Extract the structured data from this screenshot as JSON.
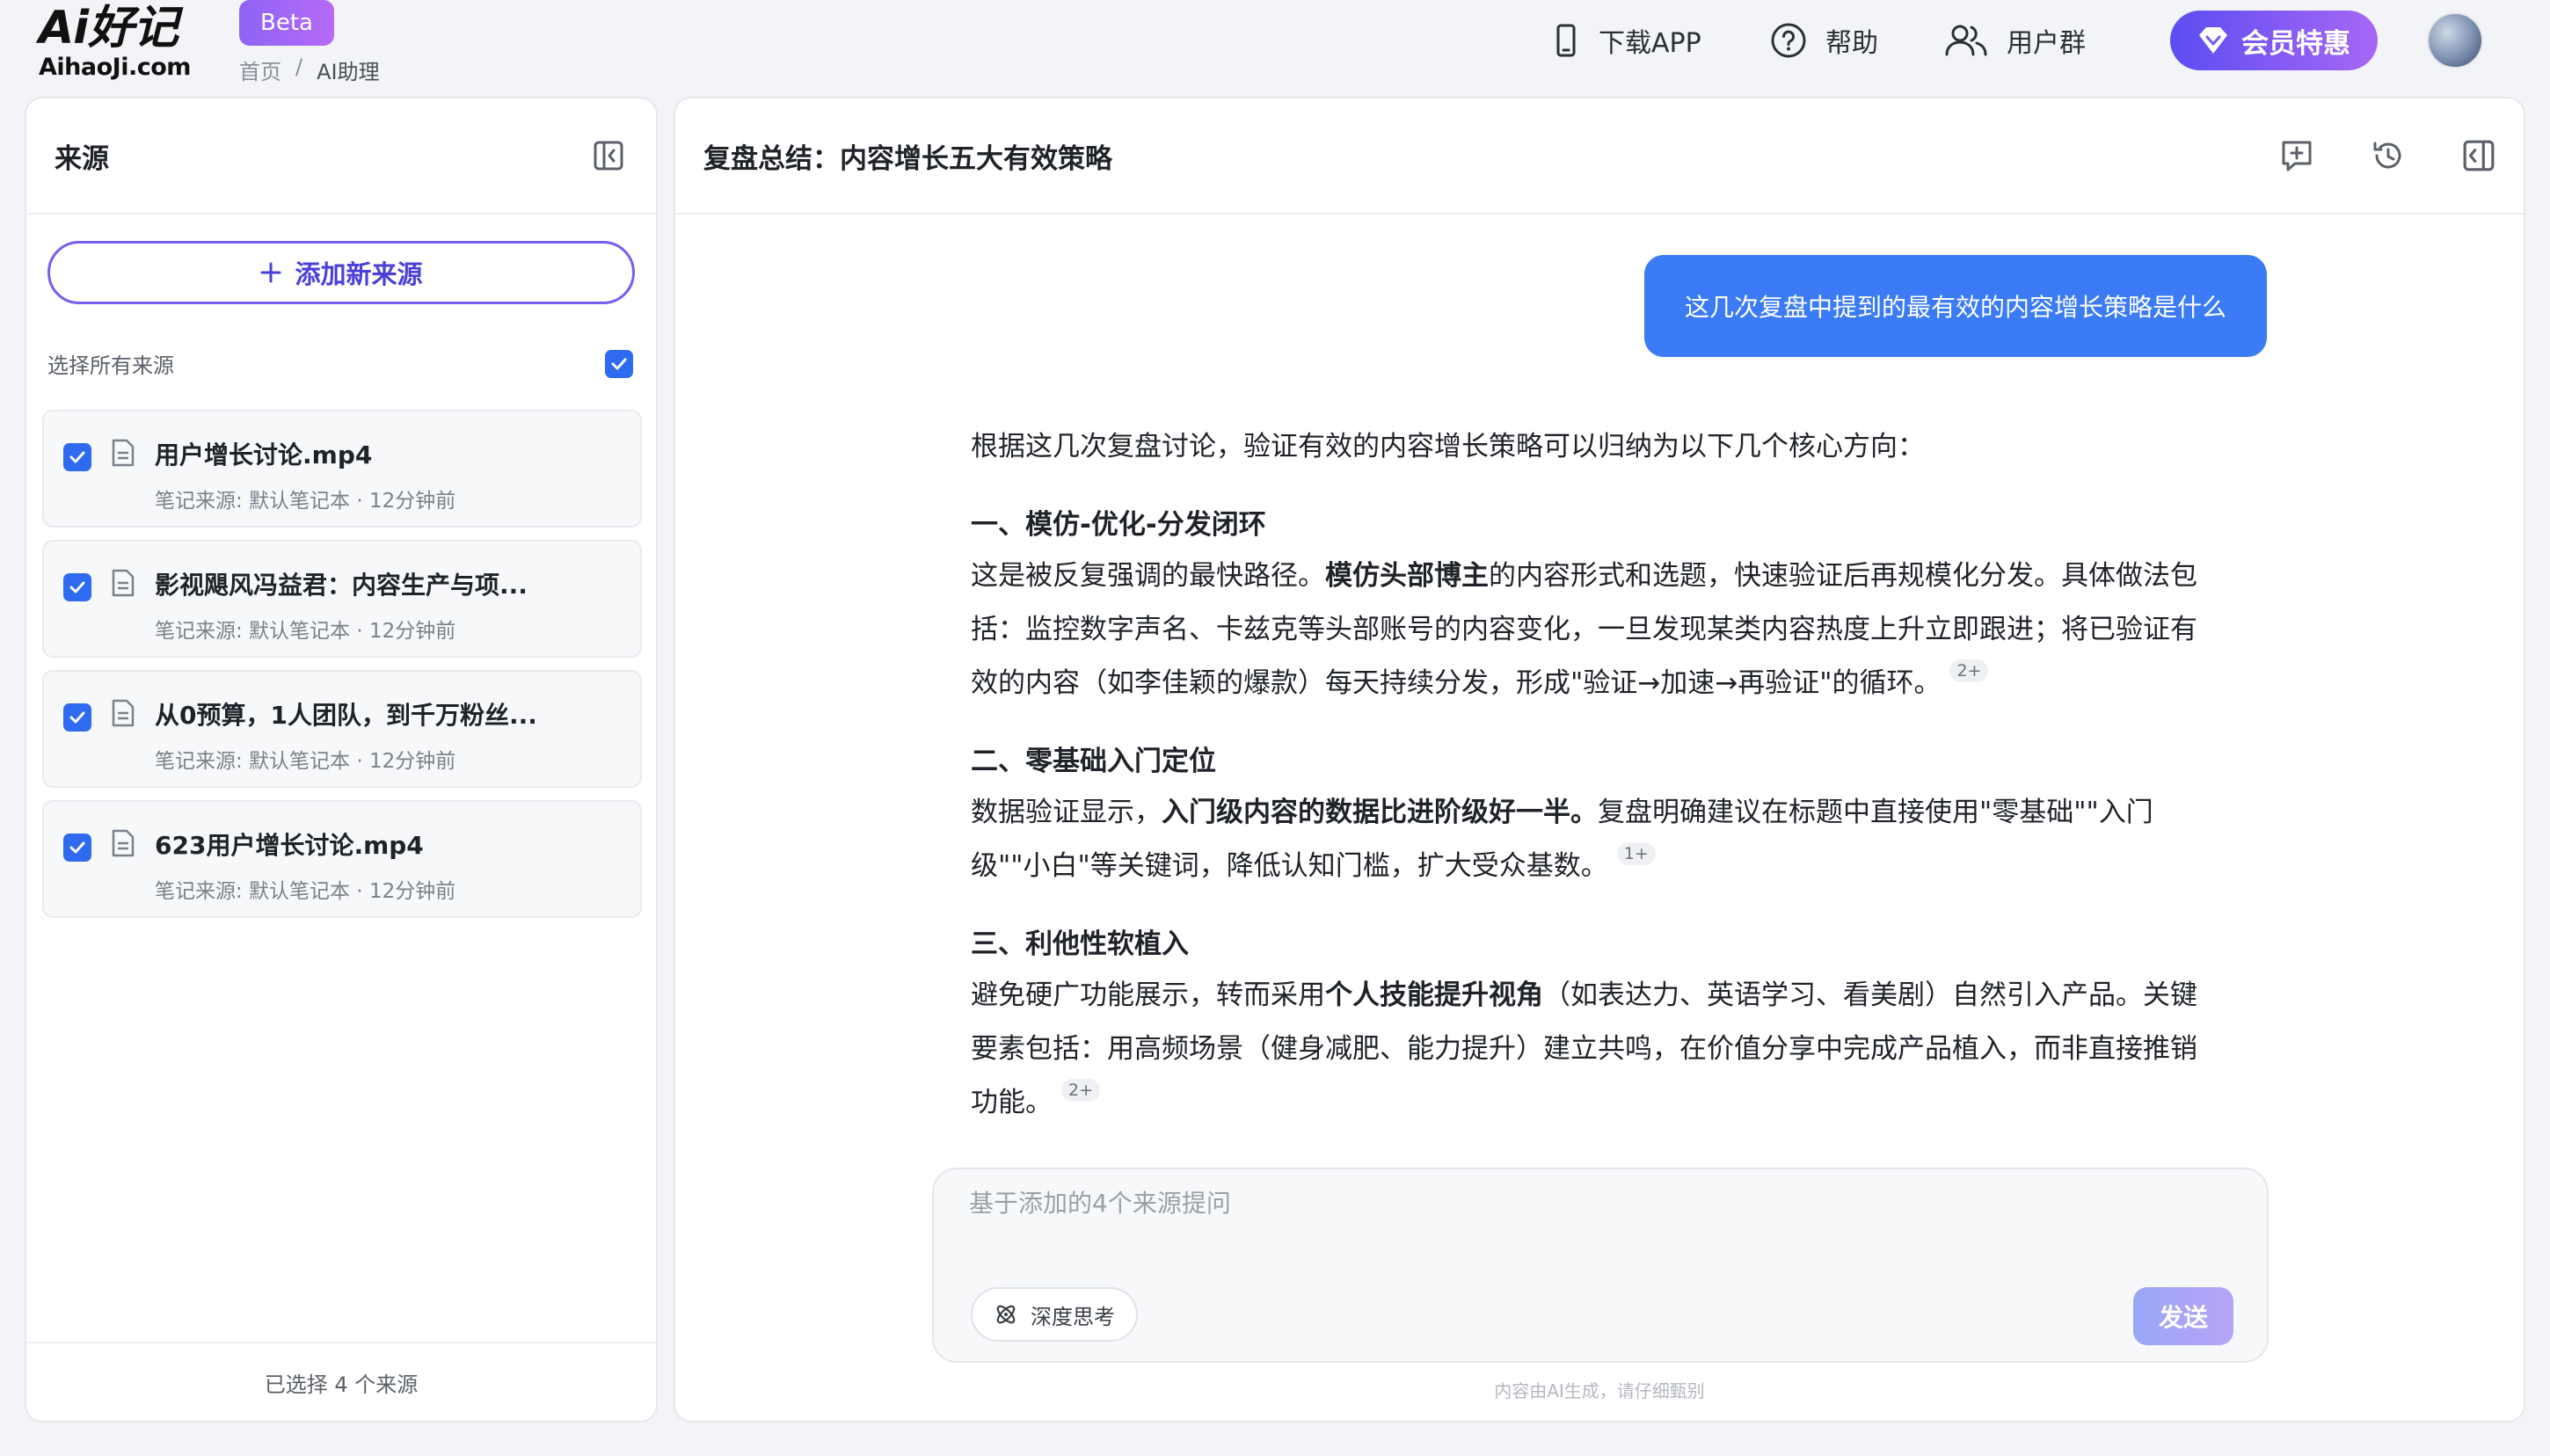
{
  "header": {
    "logo_main": "Ai好记",
    "logo_sub": "AihaoJi.com",
    "beta": "Beta",
    "breadcrumb": [
      "首页",
      "/",
      "AI助理"
    ],
    "nav": {
      "download": "下载APP",
      "help": "帮助",
      "users": "用户群",
      "vip": "会员特惠"
    }
  },
  "sources": {
    "title": "来源",
    "add_label": "添加新来源",
    "select_all": "选择所有来源",
    "items": [
      {
        "name": "用户增长讨论.mp4",
        "meta": "笔记来源: 默认笔记本 · 12分钟前"
      },
      {
        "name": "影视飓风冯益君：内容生产与项...",
        "meta": "笔记来源: 默认笔记本 · 12分钟前"
      },
      {
        "name": "从0预算，1人团队，到千万粉丝...",
        "meta": "笔记来源: 默认笔记本 · 12分钟前"
      },
      {
        "name": "623用户增长讨论.mp4",
        "meta": "笔记来源: 默认笔记本 · 12分钟前"
      }
    ],
    "footer": "已选择 4 个来源"
  },
  "chat": {
    "title": "复盘总结：内容增长五大有效策略",
    "user_message": "这几次复盘中提到的最有效的内容增长策略是什么",
    "intro": "根据这几次复盘讨论，验证有效的内容增长策略可以归纳为以下几个核心方向：",
    "s1": {
      "heading": "一、模仿-优化-分发闭环",
      "a": "这是被反复强调的最快路径。",
      "b": "模仿头部博主",
      "c": "的内容形式和选题，快速验证后再规模化分发。具体做法包括：监控数字声名、卡兹克等头部账号的内容变化，一旦发现某类内容热度上升立即跟进；将已验证有效的内容（如李佳颖的爆款）每天持续分发，形成\"验证→加速→再验证\"的循环。",
      "cite": "2+"
    },
    "s2": {
      "heading": "二、零基础入门定位",
      "a": "数据验证显示，",
      "b": "入门级内容的数据比进阶级好一半。",
      "c": "复盘明确建议在标题中直接使用\"零基础\"\"入门级\"\"小白\"等关键词，降低认知门槛，扩大受众基数。",
      "cite": "1+"
    },
    "s3": {
      "heading": "三、利他性软植入",
      "a": "避免硬广功能展示，转而采用",
      "b": "个人技能提升视角",
      "c": "（如表达力、英语学习、看美剧）自然引入产品。关键要素包括：用高频场景（健身减肥、能力提升）建立共鸣，在价值分享中完成产品植入，而非直接推销功能。",
      "cite": "2+"
    },
    "input_placeholder": "基于添加的4个来源提问",
    "deep_think": "深度思考",
    "send": "发送",
    "disclaimer": "内容由AI生成，请仔细甄别"
  },
  "colors": {
    "accent": "#3b7bf5",
    "brand_purple": "#7a5cf0",
    "checkbox": "#2f6bf0"
  },
  "icons": [
    "phone-icon",
    "help-icon",
    "users-icon",
    "diamond-icon",
    "collapse-icon",
    "new-chat-icon",
    "history-icon",
    "plus-icon",
    "check-icon",
    "document-icon",
    "atom-icon"
  ]
}
